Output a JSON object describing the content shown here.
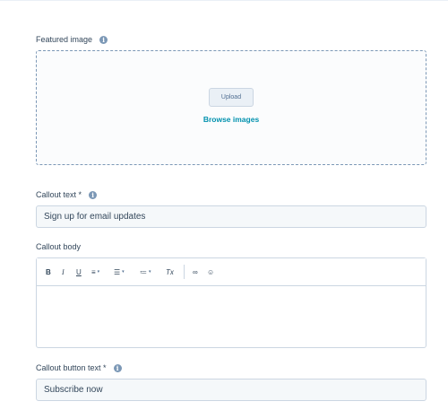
{
  "featured_image": {
    "label": "Featured image",
    "upload_label": "Upload",
    "browse_label": "Browse images"
  },
  "callout_text": {
    "label": "Callout text *",
    "value": "Sign up for email updates"
  },
  "callout_body": {
    "label": "Callout body",
    "toolbar": {
      "bold": "B",
      "italic": "I",
      "underline": "U",
      "align": "≡",
      "bullets": "☰",
      "numbers": "≔",
      "clear": "Tx",
      "link": "∞",
      "emoji": "☺",
      "caret": "▾"
    },
    "value": ""
  },
  "callout_button_text": {
    "label": "Callout button text *",
    "value": "Subscribe now"
  },
  "colors": {
    "accent": "#0091ae",
    "border": "#cbd6e2",
    "text": "#33475b",
    "input_bg": "#f5f8fa"
  }
}
